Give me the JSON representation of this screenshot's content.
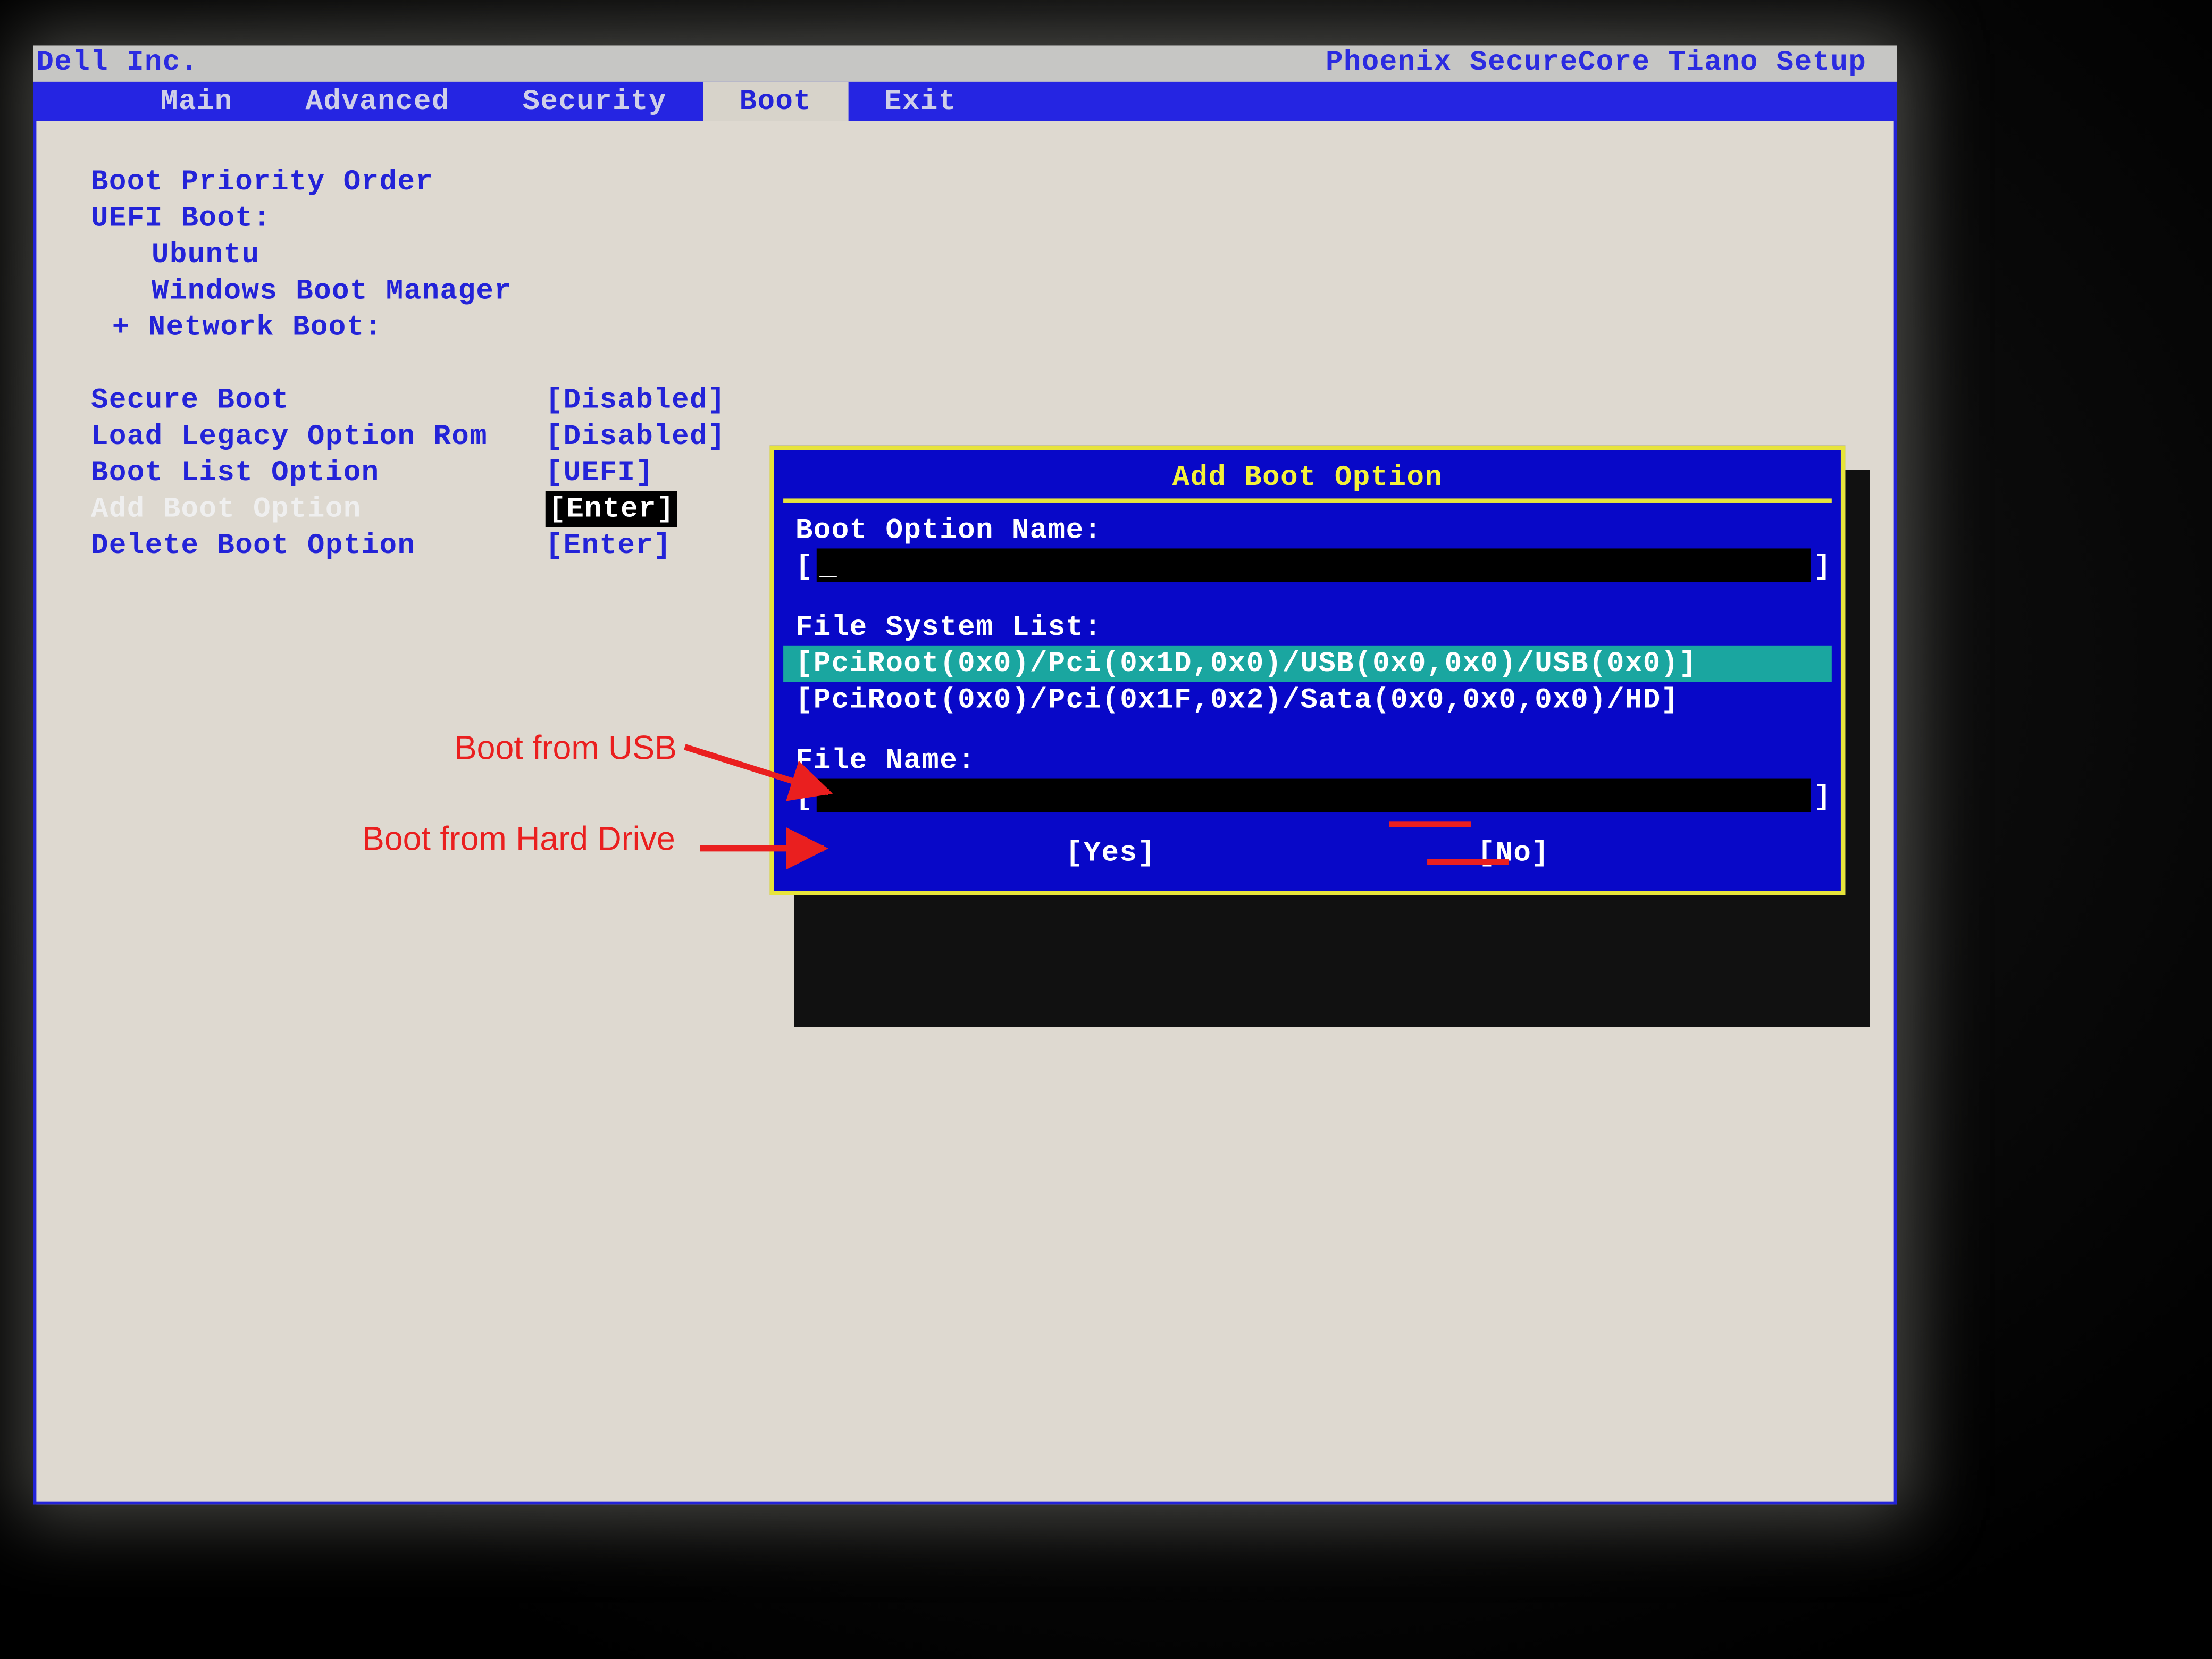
{
  "header": {
    "vendor": "Dell Inc.",
    "product": "Phoenix SecureCore Tiano Setup"
  },
  "menubar": {
    "tabs": [
      "Main",
      "Advanced",
      "Security",
      "Boot",
      "Exit"
    ],
    "active": "Boot"
  },
  "boot_page": {
    "heading": "Boot Priority Order",
    "uefi_label": "UEFI Boot:",
    "uefi_items": [
      "Ubuntu",
      "Windows Boot Manager"
    ],
    "network_label": "+ Network Boot:",
    "settings": [
      {
        "label": "Secure Boot",
        "value": "[Disabled]"
      },
      {
        "label": "Load Legacy Option Rom",
        "value": "[Disabled]"
      },
      {
        "label": "Boot List Option",
        "value": "[UEFI]"
      },
      {
        "label": "Add Boot Option",
        "value": "[Enter]",
        "selected": true
      },
      {
        "label": "Delete Boot Option",
        "value": "[Enter]"
      }
    ]
  },
  "dialog": {
    "title": "Add Boot Option",
    "name_label": "Boot Option Name:",
    "name_value": "_",
    "fs_label": "File System List:",
    "fs_items": [
      "[PciRoot(0x0)/Pci(0x1D,0x0)/USB(0x0,0x0)/USB(0x0)]",
      "[PciRoot(0x0)/Pci(0x1F,0x2)/Sata(0x0,0x0,0x0)/HD]"
    ],
    "fs_selected_index": 0,
    "file_label": "File Name:",
    "file_value": "",
    "yes_label": "[Yes]",
    "no_label": "[No]"
  },
  "annotations": {
    "usb_label": "Boot from USB",
    "hdd_label": "Boot from Hard Drive"
  }
}
